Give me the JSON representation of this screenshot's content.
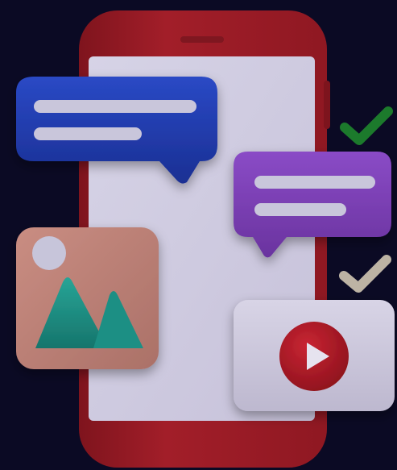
{
  "image": {
    "background_color": "#0b0a24"
  },
  "phone": {
    "body_color": "#9e1d27",
    "screen_color": "#cfcbe0",
    "speaker_color": "#7f1720"
  },
  "chat_bubble_blue": {
    "color": "#1e3cb3",
    "line_color": "#c9c6db",
    "lines": 2
  },
  "chat_bubble_purple": {
    "color": "#7b3fb6",
    "line_color": "#c9c6db",
    "lines": 2
  },
  "image_card": {
    "card_color": "#c2847a",
    "sun_color": "#c7c5da",
    "mountain_color": "#1f8f84"
  },
  "video_card": {
    "card_color": "#cfcadc",
    "play_button_color": "#b51a26",
    "play_icon_color": "#e6e3ef"
  },
  "checkmarks": {
    "first_color": "#1c7a2c",
    "second_color": "#bdb3a4"
  }
}
